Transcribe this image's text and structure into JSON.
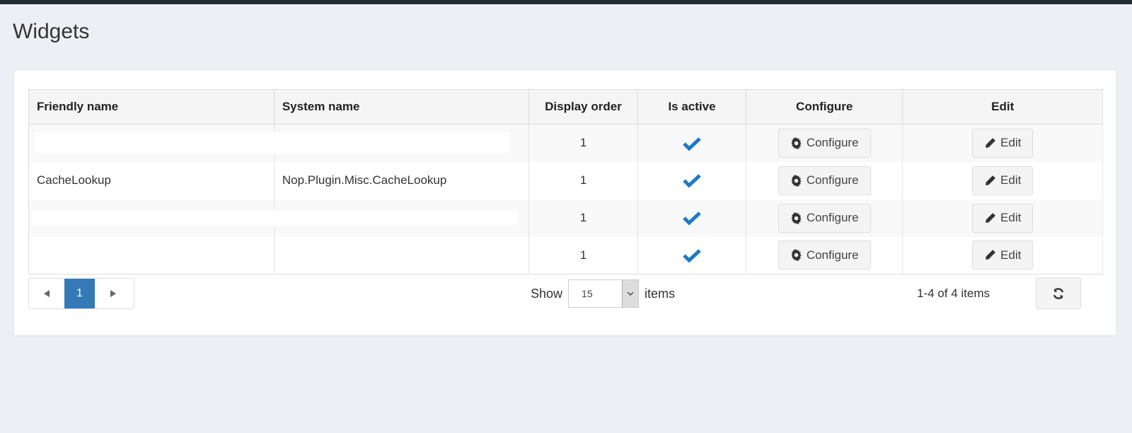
{
  "page": {
    "title": "Widgets"
  },
  "table": {
    "columns": [
      "Friendly name",
      "System name",
      "Display order",
      "Is active",
      "Configure",
      "Edit"
    ],
    "rows": [
      {
        "friendly_name": "",
        "system_name": "",
        "display_order": "1",
        "is_active": true
      },
      {
        "friendly_name": "CacheLookup",
        "system_name": "Nop.Plugin.Misc.CacheLookup",
        "display_order": "1",
        "is_active": true
      },
      {
        "friendly_name": "",
        "system_name": "",
        "display_order": "1",
        "is_active": true
      },
      {
        "friendly_name": "",
        "system_name": "",
        "display_order": "1",
        "is_active": true
      }
    ],
    "configure_label": "Configure",
    "edit_label": "Edit"
  },
  "pager": {
    "prev_icon": "caret-left-icon",
    "current_page": "1",
    "next_icon": "caret-right-icon"
  },
  "page_size": {
    "show_label": "Show",
    "value": "15",
    "items_label": "items"
  },
  "range_info": "1-4 of 4 items",
  "icons": {
    "check": "check-icon",
    "configure": "gear-icon",
    "edit": "pencil-icon",
    "refresh": "refresh-icon"
  },
  "colors": {
    "accent": "#337ab7",
    "check": "#1f7ac6",
    "topbar": "#222d32"
  }
}
